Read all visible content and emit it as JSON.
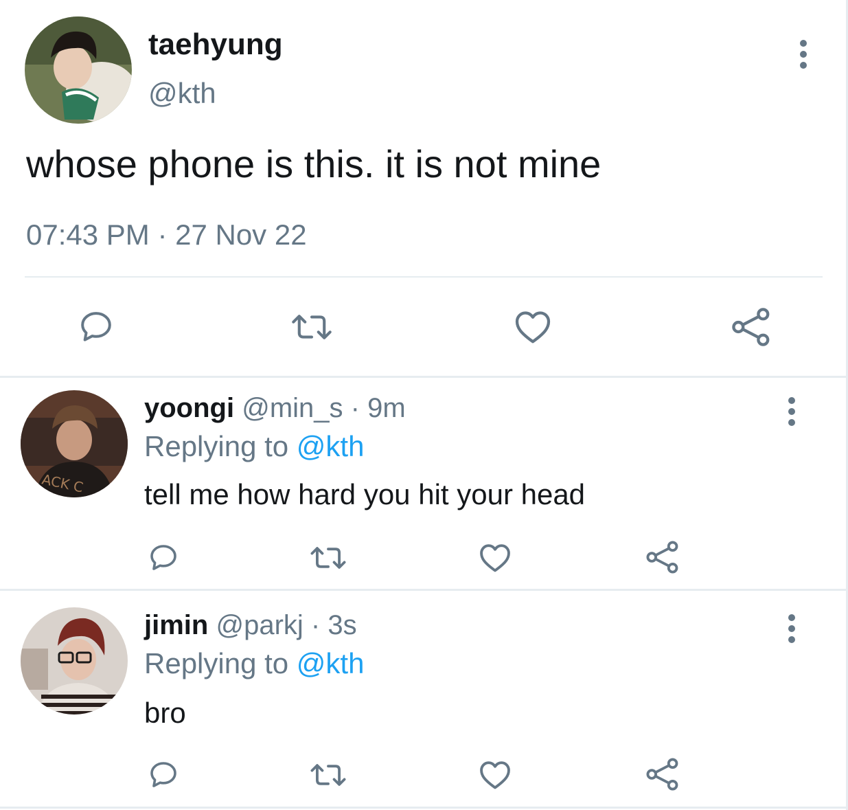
{
  "colors": {
    "text_primary": "#14171a",
    "text_secondary": "#657786",
    "link": "#1da1f2",
    "divider": "#e6ecf0",
    "icon": "#657786"
  },
  "main_tweet": {
    "author_name": "taehyung",
    "author_handle": "@kth",
    "text": "whose phone is this. it is not mine",
    "timestamp": "07:43 PM · 27 Nov 22",
    "avatar_icon": "user-avatar",
    "menu_icon": "more-vertical-icon",
    "actions": [
      "reply-icon",
      "retweet-icon",
      "like-icon",
      "share-icon"
    ]
  },
  "replies": [
    {
      "author_name": "yoongi",
      "author_handle": "@min_s",
      "time_ago": "9m",
      "separator": "·",
      "replying_label": "Replying to",
      "replying_to": "@kth",
      "text": "tell me how hard you hit your head",
      "avatar_icon": "user-avatar"
    },
    {
      "author_name": "jimin",
      "author_handle": "@parkj",
      "time_ago": "3s",
      "separator": "·",
      "replying_label": "Replying to",
      "replying_to": "@kth",
      "text": "bro",
      "avatar_icon": "user-avatar"
    }
  ]
}
